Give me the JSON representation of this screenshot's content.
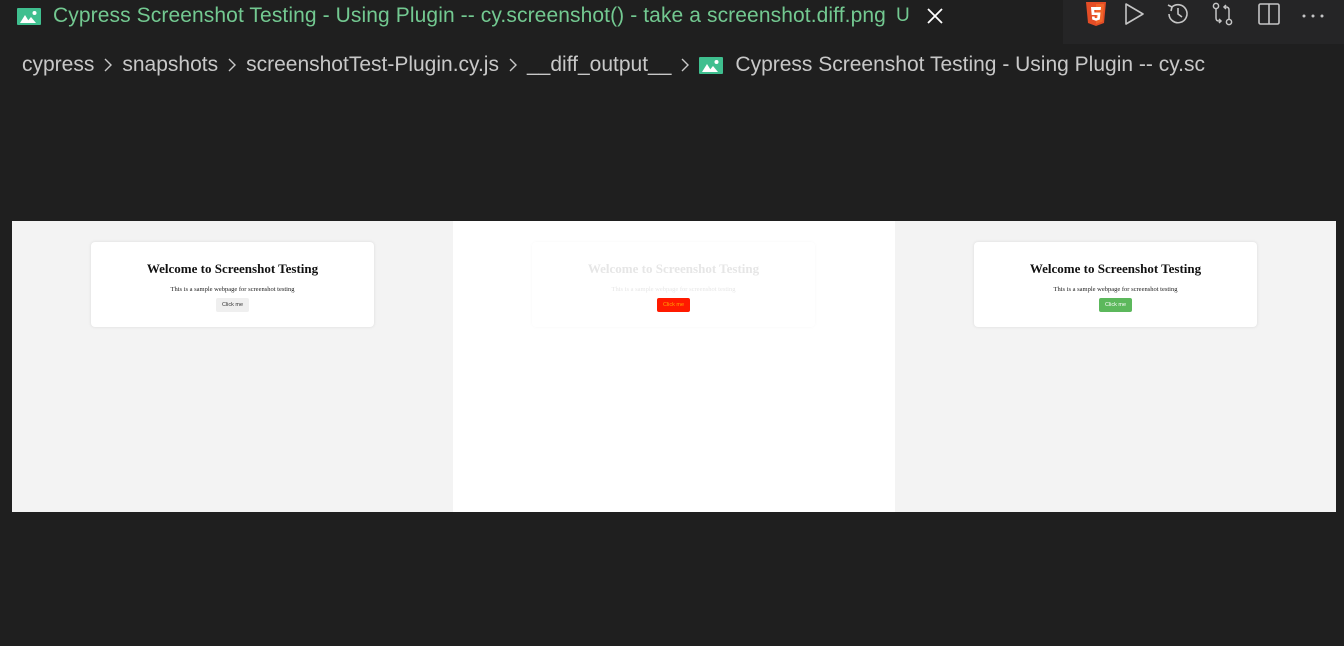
{
  "tab": {
    "title": "Cypress Screenshot Testing - Using Plugin -- cy.screenshot() - take a screenshot.diff.png",
    "status": "U",
    "icon": "image-file-icon",
    "close_icon": "close-icon"
  },
  "actions": [
    {
      "name": "html5-icon",
      "label": "Open Preview"
    },
    {
      "name": "run-icon",
      "label": "Run"
    },
    {
      "name": "timeline-history-icon",
      "label": "Timeline"
    },
    {
      "name": "compare-changes-icon",
      "label": "Open Changes"
    },
    {
      "name": "split-editor-icon",
      "label": "Split Editor"
    },
    {
      "name": "more-actions-icon",
      "label": "More Actions"
    }
  ],
  "breadcrumb": {
    "items": [
      "cypress",
      "snapshots",
      "screenshotTest-Plugin.cy.js",
      "__diff_output__"
    ],
    "file": "Cypress Screenshot Testing - Using Plugin -- cy.sc",
    "separator": "chevron-right-icon"
  },
  "colors": {
    "tab_title": "#73c991",
    "image_icon": "#3fbf8f",
    "diff_highlight": "#ff1a00",
    "button_green": "#5cb85c"
  },
  "preview": {
    "panels": [
      {
        "role": "baseline",
        "heading": "Welcome to Screenshot Testing",
        "text": "This is a sample webpage for screenshot testing",
        "button": "Click me"
      },
      {
        "role": "diff",
        "heading": "Welcome to Screenshot Testing",
        "text": "This is a sample webpage for screenshot testing",
        "button": "Click me"
      },
      {
        "role": "current",
        "heading": "Welcome to Screenshot Testing",
        "text": "This is a sample webpage for screenshot testing",
        "button": "Click me"
      }
    ]
  }
}
